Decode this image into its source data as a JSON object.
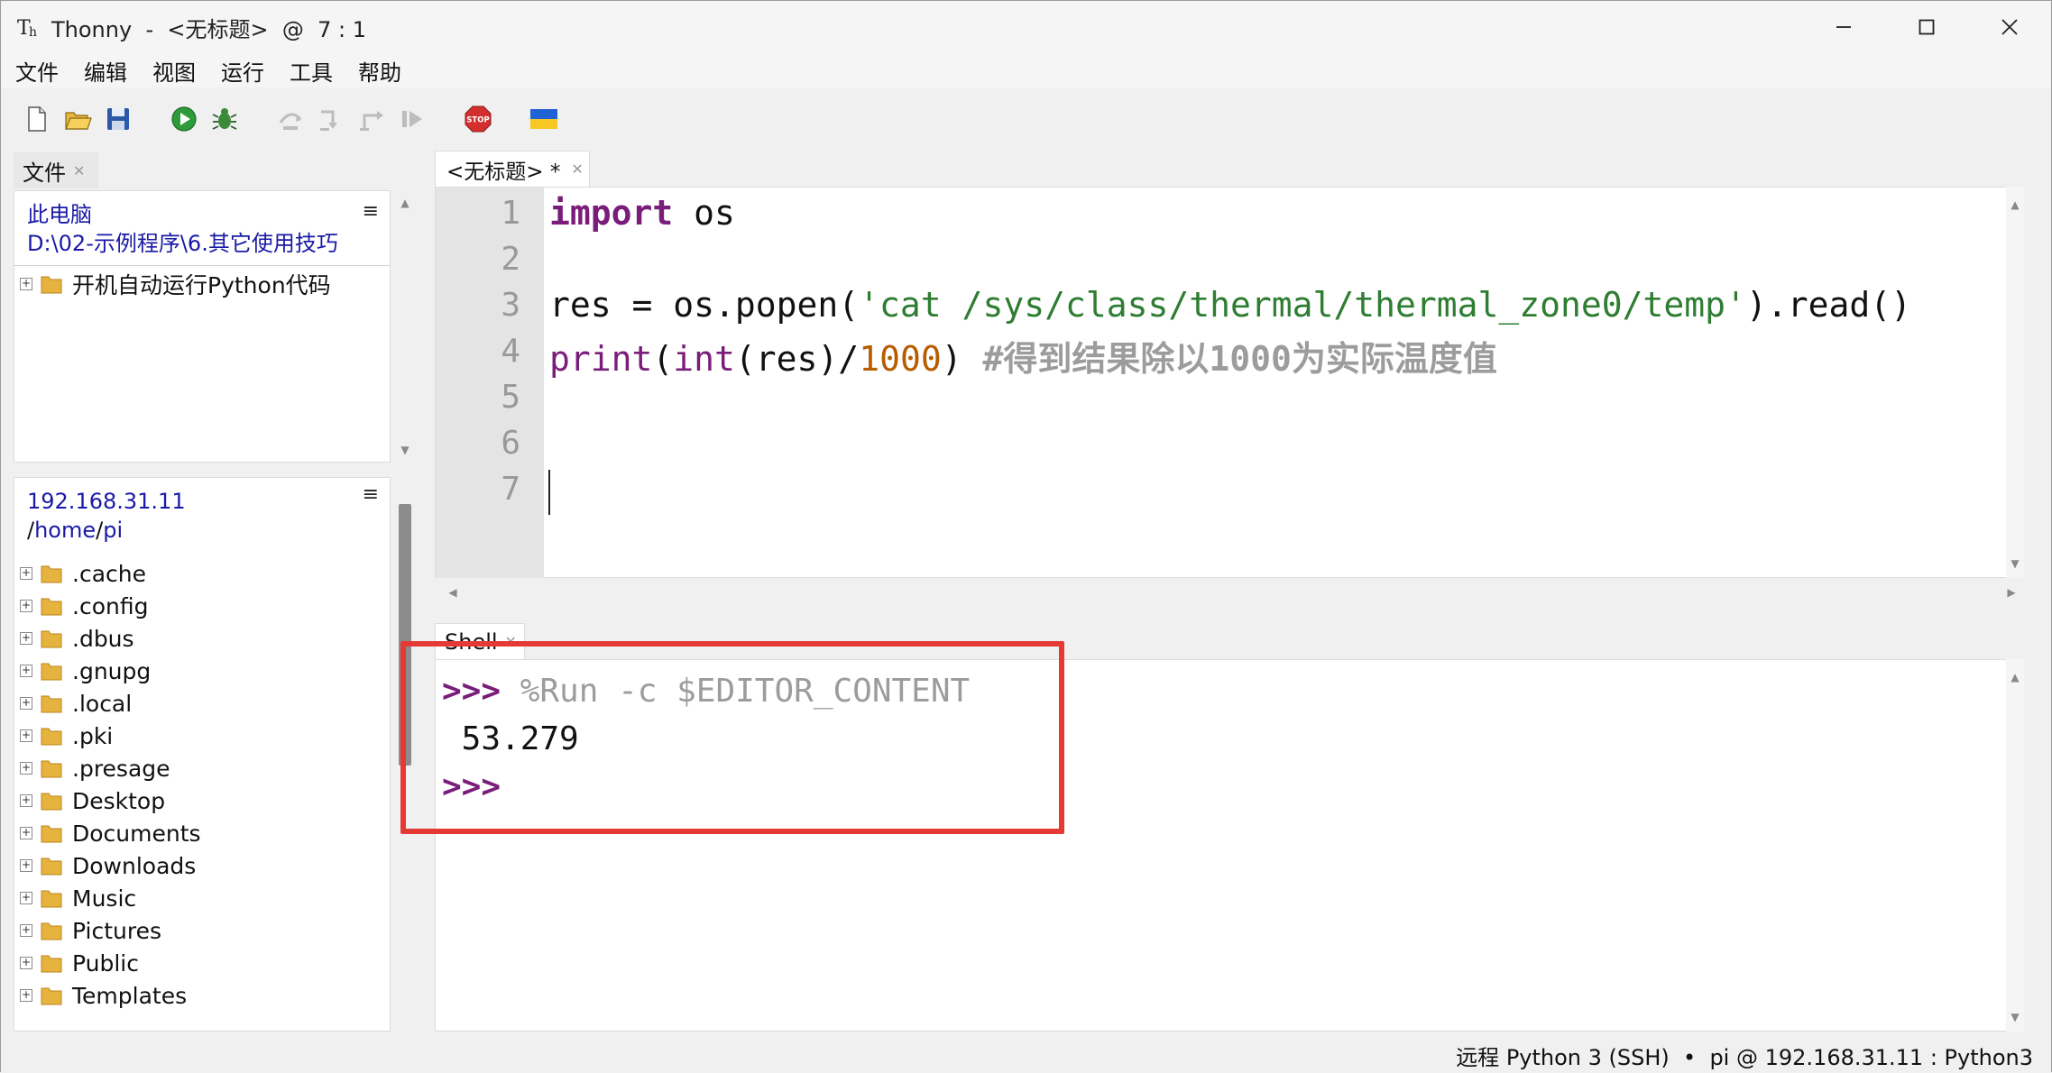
{
  "window": {
    "title": "Thonny  -  <无标题>  @  7 : 1",
    "app_icon": "thonny-icon",
    "controls": [
      "minimize-icon",
      "maximize-icon",
      "close-icon"
    ]
  },
  "menu": [
    "文件",
    "编辑",
    "视图",
    "运行",
    "工具",
    "帮助"
  ],
  "toolbar": {
    "icons": [
      "new-file-icon",
      "open-file-icon",
      "save-icon",
      "run-icon",
      "debug-icon",
      "step-over-icon",
      "step-into-icon",
      "step-out-icon",
      "resume-icon",
      "stop-icon",
      "ukraine-flag-icon"
    ],
    "stop_label": "STOP"
  },
  "files_panel": {
    "tab_label": "文件",
    "local": {
      "path_line1": "此电脑",
      "path_line2": "D:\\02-示例程序\\6.其它使用技巧",
      "menu_symbol": "≡",
      "items": [
        "开机自动运行Python代码"
      ]
    },
    "remote": {
      "host": "192.168.31.11",
      "path_sep1": "/",
      "path_part1": "home",
      "path_sep2": "/",
      "path_part2": "pi",
      "menu_symbol": "≡",
      "items": [
        ".cache",
        ".config",
        ".dbus",
        ".gnupg",
        ".local",
        ".pki",
        ".presage",
        "Desktop",
        "Documents",
        "Downloads",
        "Music",
        "Pictures",
        "Public",
        "Templates"
      ]
    }
  },
  "editor": {
    "tab_label": "<无标题> *",
    "line_numbers": [
      "1",
      "2",
      "3",
      "4",
      "5",
      "6",
      "7"
    ],
    "code": {
      "l1_kw": "import",
      "l1_rest": " os",
      "l3_a": "res = os.popen(",
      "l3_str": "'cat /sys/class/thermal/thermal_zone0/temp'",
      "l3_b": ").read()",
      "l4_print": "print",
      "l4_a": "(",
      "l4_int": "int",
      "l4_b": "(res)/",
      "l4_num": "1000",
      "l4_c": ") ",
      "l4_cmt": "#得到结果除以1000为实际温度值"
    }
  },
  "shell": {
    "tab_label": "Shell",
    "prompt": ">>>",
    "command": " %Run -c $EDITOR_CONTENT",
    "output": " 53.279",
    "prompt2": ">>>"
  },
  "status_bar": {
    "text": "远程 Python 3 (SSH)  •  pi @ 192.168.31.11 : Python3"
  },
  "colors": {
    "keyword": "#7a1d7a",
    "string": "#2e7d32",
    "number": "#b85c00",
    "comment": "#9c9c9c",
    "highlight_box": "#e53935"
  }
}
